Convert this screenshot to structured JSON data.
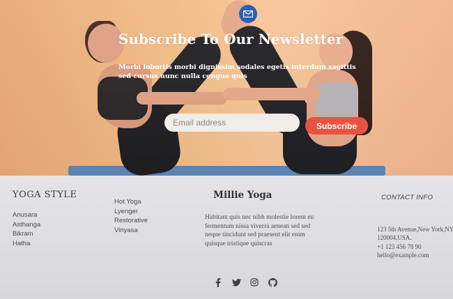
{
  "newsletter": {
    "title": "Subscribe To Our Newsletter",
    "subtitle": "Morbi lobortis morbi dignissim sodales egetis interdum sagittis sed cursus nunc nulla congue quis",
    "email_placeholder": "Email address",
    "subscribe_label": "Subscribe"
  },
  "footer": {
    "yoga_style": {
      "title": "YOGA STYLE",
      "items_a": [
        "Anusara",
        "Asthanga",
        "Bikram",
        "Hatha"
      ],
      "items_b": [
        "Hot Yoga",
        "Lyenger",
        "Restorative",
        "Vinyasa"
      ]
    },
    "brand": {
      "name": "Millie Yoga",
      "description": "Habitant quis nec nibh molestie lorem eu fermentum nissa viverra aenean sed sed neque tincidunt sed praesent elit enim quisque tristique quiscras"
    },
    "contact": {
      "title": "CONTACT INFO",
      "address": "123 5th Avenue,New York,NY 120004,USA.",
      "phone": "+1 123 456 78 90",
      "email": "hello@example.com"
    },
    "social": [
      "facebook-icon",
      "twitter-icon",
      "instagram-icon",
      "github-icon"
    ]
  },
  "colors": {
    "accent": "#e65441",
    "badge": "#2c5fb3",
    "footer_bg": "#e0e0e2"
  }
}
